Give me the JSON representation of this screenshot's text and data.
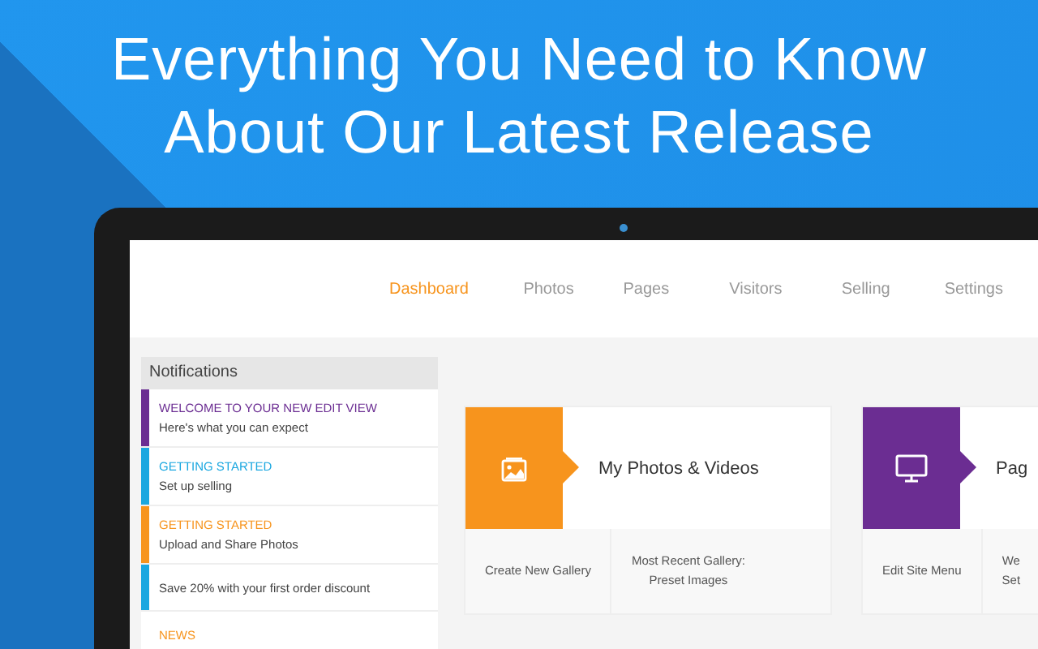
{
  "headline": [
    "Everything You Need to Know",
    "About Our Latest Release"
  ],
  "nav": [
    {
      "label": "Dashboard",
      "selected": true
    },
    {
      "label": "Photos",
      "selected": false
    },
    {
      "label": "Pages",
      "selected": false
    },
    {
      "label": "Visitors",
      "selected": false
    },
    {
      "label": "Selling",
      "selected": false
    },
    {
      "label": "Settings",
      "selected": false
    }
  ],
  "notifications": {
    "title": "Notifications",
    "items": [
      {
        "title": "WELCOME TO YOUR NEW EDIT VIEW",
        "text": "Here's what you can expect",
        "color": "#6b2d92",
        "marked": true
      },
      {
        "title": "GETTING STARTED",
        "text": "Set up selling",
        "color": "#1aa7e0",
        "marked": true
      },
      {
        "title": "GETTING STARTED",
        "text": "Upload and Share Photos",
        "color": "#f7941d",
        "marked": true
      },
      {
        "text": "Save 20% with your first order discount",
        "color": "#1aa7e0",
        "marked": true
      },
      {
        "title": "NEWS",
        "color": "#f7941d",
        "marked": false
      }
    ]
  },
  "cards": [
    {
      "kind": "photo",
      "title": "My Photos & Videos",
      "color": "#f7941d",
      "links": [
        [
          "Create New Gallery"
        ],
        [
          "Most Recent Gallery:",
          "Preset Images"
        ]
      ]
    },
    {
      "kind": "monitor",
      "title": "Pag",
      "color": "#6b2d92",
      "links": [
        [
          "Edit Site Menu"
        ],
        [
          "We",
          "Set"
        ]
      ]
    }
  ]
}
